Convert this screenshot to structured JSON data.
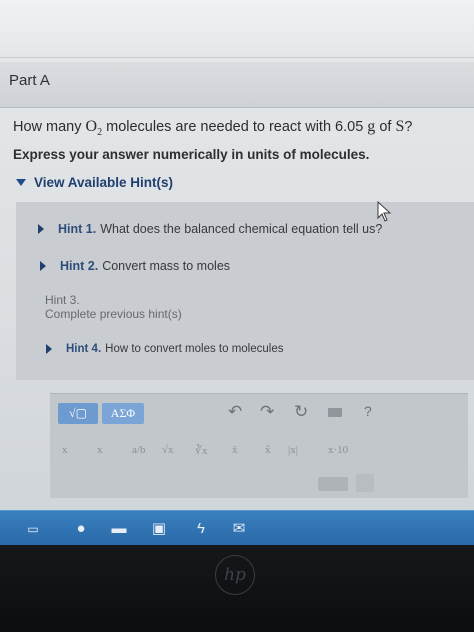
{
  "part": {
    "title": "Part A"
  },
  "question": {
    "pre": "How many",
    "molecule": "O",
    "subscript": "2",
    "mid": "molecules are needed to react with 6.05",
    "unit": "g",
    "of": "of",
    "element": "S",
    "end": "?"
  },
  "instruction": "Express your answer numerically in units of molecules.",
  "hints": {
    "toggle_label": "View Available Hint(s)",
    "items": [
      {
        "label": "Hint 1.",
        "text": "What does the balanced chemical equation tell us?"
      },
      {
        "label": "Hint 2.",
        "text": "Convert mass to moles"
      },
      {
        "label": "Hint 3.",
        "text": "Complete previous hint(s)"
      },
      {
        "label": "Hint 4.",
        "text": "How to convert moles to molecules"
      }
    ]
  },
  "toolbar": {
    "greek_label": "ΑΣΦ",
    "template_label": "√▢",
    "undo": "↶",
    "redo": "↷",
    "reset": "↻",
    "help": "?",
    "math": [
      "x",
      "x",
      "a/b",
      "√x",
      "∛x",
      "x̄",
      "x̂",
      "|x|",
      "x·10"
    ]
  },
  "hp_logo": "hp",
  "colors": {
    "accent": "#6d9bd0",
    "hint_link": "#2e4e7a",
    "taskbar": "#2a6aa8"
  }
}
